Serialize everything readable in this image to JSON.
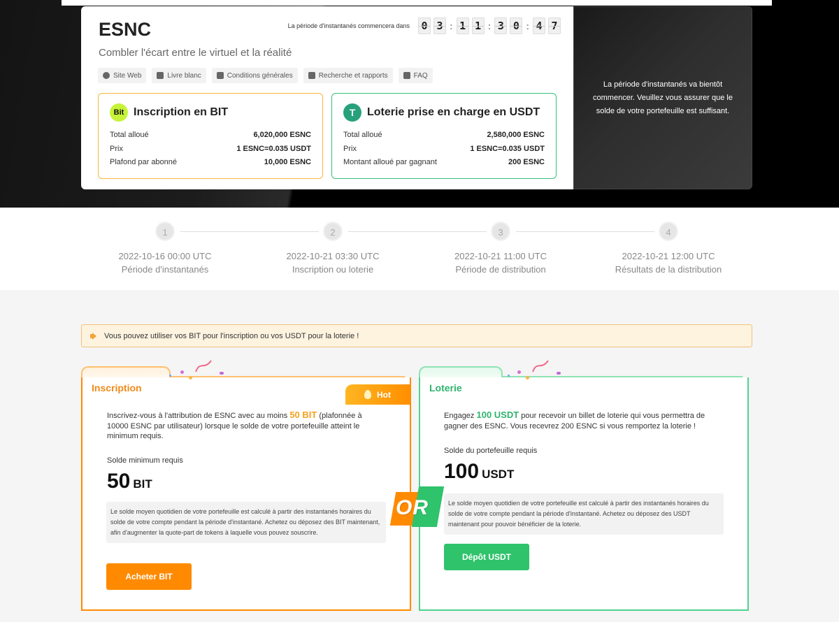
{
  "project": {
    "title": "ESNC",
    "subtitle": "Combler l'écart entre le virtuel et la réalité",
    "links": [
      "Site Web",
      "Livre blanc",
      "Conditions générales",
      "Recherche et rapports",
      "FAQ"
    ]
  },
  "countdown": {
    "label": "La période d'instantanés commencera dans",
    "digits": [
      "0",
      "3",
      "1",
      "1",
      "3",
      "0",
      "4",
      "7"
    ]
  },
  "bit_box": {
    "badge": "Bit",
    "title": "Inscription en BIT",
    "rows": [
      {
        "k": "Total alloué",
        "v": "6,020,000 ESNC"
      },
      {
        "k": "Prix",
        "v": "1 ESNC=0.035 USDT"
      },
      {
        "k": "Plafond par abonné",
        "v": "10,000 ESNC"
      }
    ]
  },
  "usdt_box": {
    "badge": "T",
    "title": "Loterie prise en charge en USDT",
    "rows": [
      {
        "k": "Total alloué",
        "v": "2,580,000 ESNC"
      },
      {
        "k": "Prix",
        "v": "1 ESNC=0.035 USDT"
      },
      {
        "k": "Montant alloué par gagnant",
        "v": "200 ESNC"
      }
    ]
  },
  "notice": "La période d'instantanés va bientôt commencer. Veuillez vous assurer que le solde de votre portefeuille est suffisant.",
  "steps": [
    {
      "num": "1",
      "date": "2022-10-16 00:00 UTC",
      "label": "Période d'instantanés"
    },
    {
      "num": "2",
      "date": "2022-10-21 03:30 UTC",
      "label": "Inscription ou loterie"
    },
    {
      "num": "3",
      "date": "2022-10-21 11:00 UTC",
      "label": "Période de distribution"
    },
    {
      "num": "4",
      "date": "2022-10-21 12:00 UTC",
      "label": "Résultats de la distribution"
    }
  ],
  "banner": "Vous pouvez utiliser vos BIT pour l'inscription ou vos USDT pour la loterie !",
  "inscription": {
    "tab": "Inscription",
    "hot": "Hot",
    "desc_pre": "Inscrivez-vous à l'attribution de ESNC avec au moins ",
    "desc_hl": "50 BIT",
    "desc_post": " (plafonnée à 10000 ESNC par utilisateur) lorsque le solde de votre portefeuille atteint le minimum requis.",
    "req_label": "Solde minimum requis",
    "amount": "50",
    "unit": "BIT",
    "note": "Le solde moyen quotidien de votre portefeuille est calculé à partir des instantanés horaires du solde de votre compte pendant la période d'instantané. Achetez ou déposez des BIT maintenant, afin d'augmenter la quote-part de tokens à laquelle vous pouvez souscrire.",
    "button": "Acheter BIT"
  },
  "or_label": "OR",
  "loterie": {
    "tab": "Loterie",
    "desc_pre": "Engagez ",
    "desc_hl": "100 USDT",
    "desc_post": " pour recevoir un billet de loterie qui vous permettra de gagner des ESNC. Vous recevrez 200 ESNC si vous remportez la loterie !",
    "req_label": "Solde du portefeuille requis",
    "amount": "100",
    "unit": "USDT",
    "note": "Le solde moyen quotidien de votre portefeuille est calculé à partir des instantanés horaires du solde de votre compte pendant la période d'instantané. Achetez ou déposez des USDT maintenant pour pouvoir bénéficier de la loterie.",
    "button": "Dépôt USDT"
  },
  "colors": {
    "orange": "#ff8a00",
    "green": "#2fc36c",
    "gold": "#f6b73c"
  }
}
